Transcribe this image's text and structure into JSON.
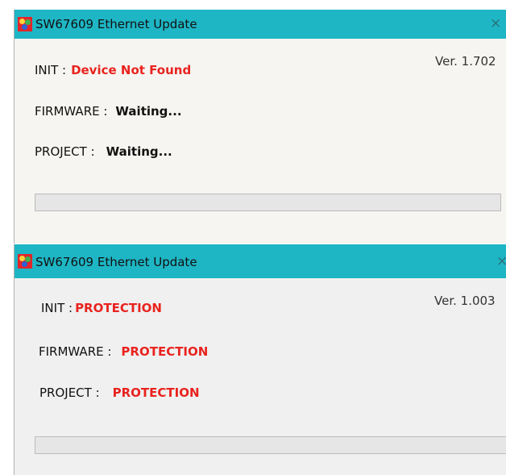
{
  "windows": [
    {
      "title": "SW67609 Ethernet Update",
      "close_icon": "×",
      "version": "Ver. 1.702",
      "init": {
        "label": "INIT :",
        "value": "Device Not Found",
        "value_color": "#e8231f"
      },
      "firmware": {
        "label": "FIRMWARE :",
        "value": "Waiting...",
        "value_color": "#111111"
      },
      "project": {
        "label": "PROJECT :",
        "value": "Waiting...",
        "value_color": "#111111"
      },
      "progress": 0
    },
    {
      "title": "SW67609 Ethernet Update",
      "close_icon": "×",
      "version": "Ver. 1.003",
      "init": {
        "label": "INIT :",
        "value": "PROTECTION",
        "value_color": "#e8231f"
      },
      "firmware": {
        "label": "FIRMWARE :",
        "value": "PROTECTION",
        "value_color": "#e8231f"
      },
      "project": {
        "label": "PROJECT :",
        "value": "PROTECTION",
        "value_color": "#e8231f"
      },
      "progress": 0
    }
  ],
  "colors": {
    "titlebar": "#1eb6c5",
    "status_red": "#e8231f",
    "app_icon": "#e3242b"
  },
  "icons": {
    "app": "app-logo-icon",
    "close": "close-icon"
  }
}
